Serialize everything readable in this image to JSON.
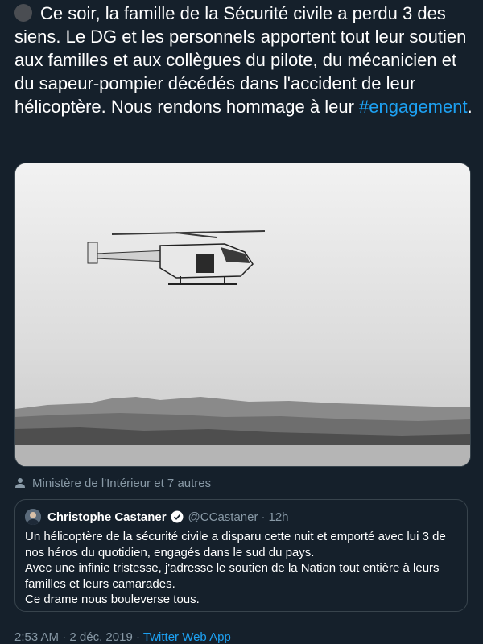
{
  "tweet": {
    "text_before": "Ce soir, la famille de la Sécurité civile a perdu 3 des siens. Le DG et les personnels apportent tout leur soutien aux familles et aux collègues du pilote, du mécanicien et du sapeur-pompier décédés dans l'accident de leur hélicoptère. Nous rendons hommage à leur ",
    "hashtag": "#engagement",
    "text_after": ".",
    "emoji_icon": "black-circle-emoji",
    "media_icon": "helicopter-photo"
  },
  "tagged": {
    "icon": "person-icon",
    "text": "Ministère de l'Intérieur et 7 autres"
  },
  "quote": {
    "name": "Christophe Castaner",
    "verified_icon": "verified-badge-icon",
    "handle": "@CCastaner",
    "dot": "·",
    "time": "12h",
    "body": "Un hélicoptère de la sécurité civile a disparu cette nuit et emporté avec lui 3 de nos héros du quotidien, engagés dans le sud du pays.\nAvec une infinie tristesse, j'adresse le soutien de la Nation tout entière à leurs familles et leurs camarades.\nCe drame nous bouleverse tous."
  },
  "meta": {
    "time": "2:53 AM",
    "separator1": " · ",
    "date": "2 déc. 2019",
    "separator2": " · ",
    "app": "Twitter Web App"
  },
  "colors": {
    "background": "#15202b",
    "link": "#1da1f2",
    "secondary": "#8899a6",
    "border": "#38444d"
  }
}
